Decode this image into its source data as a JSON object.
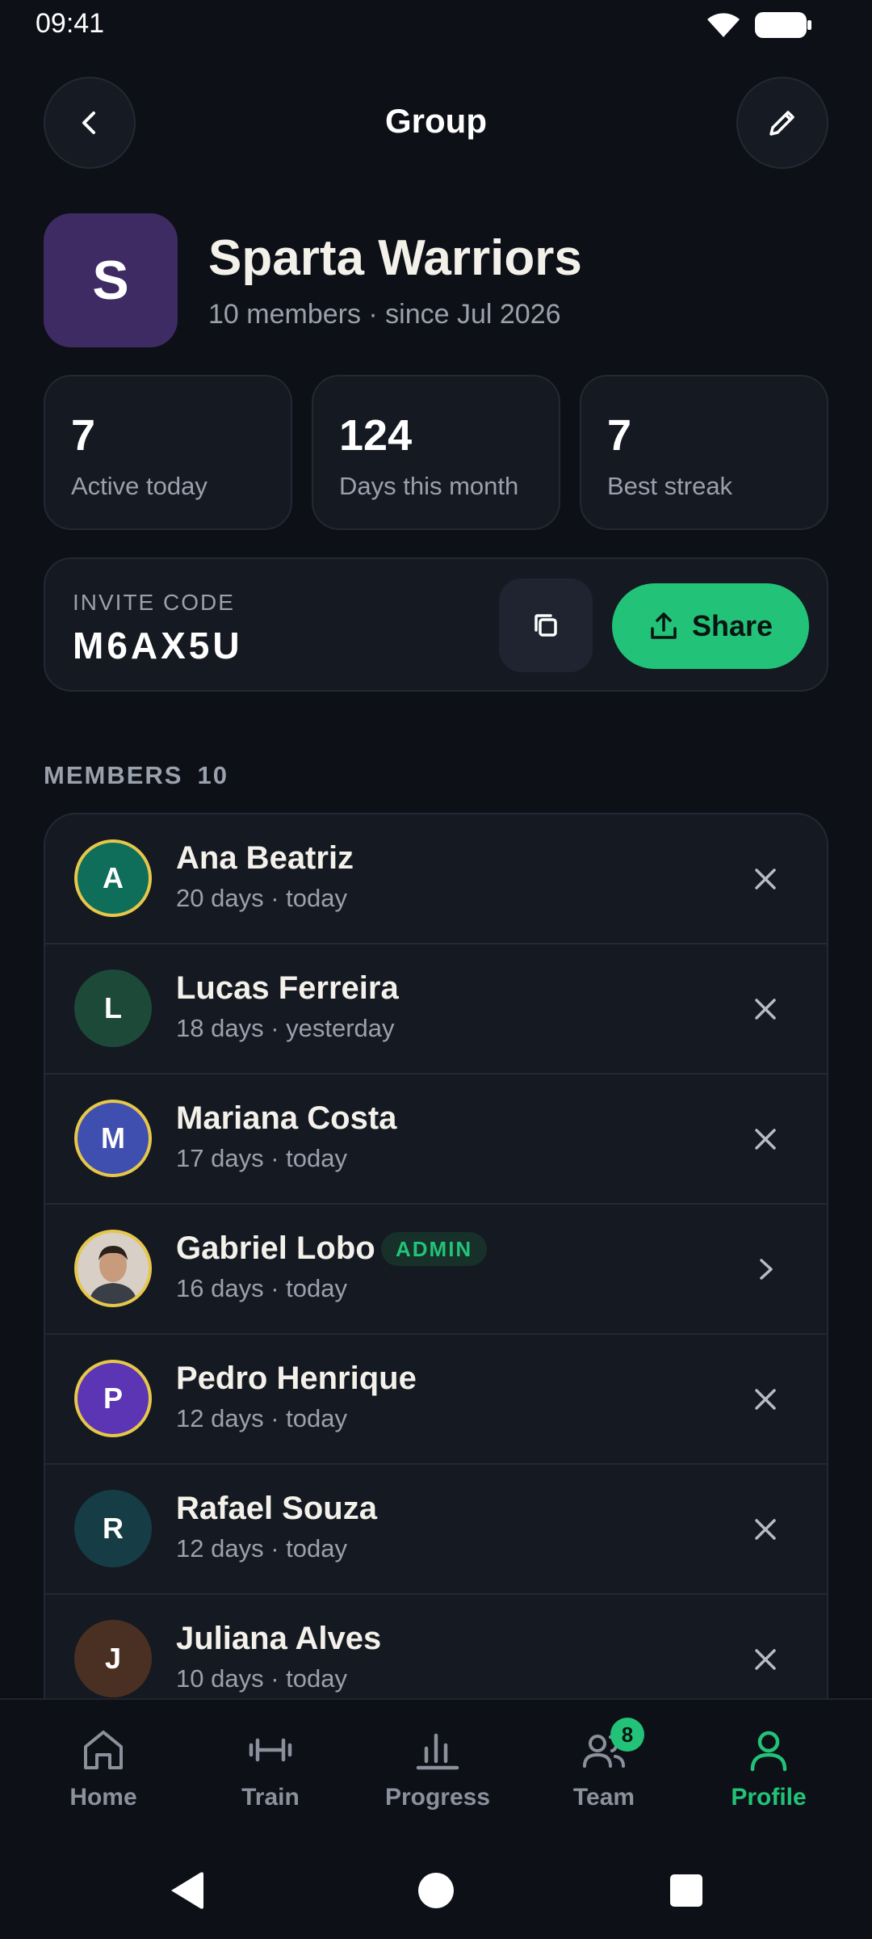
{
  "status_bar": {
    "time": "09:41"
  },
  "header": {
    "title": "Group"
  },
  "group": {
    "initial": "S",
    "name": "Sparta Warriors",
    "meta": "10 members · since Jul 2026",
    "avatar_color": "#3f2b63"
  },
  "stats": [
    {
      "value": "7",
      "label": "Active today"
    },
    {
      "value": "124",
      "label": "Days this month"
    },
    {
      "value": "7",
      "label": "Best streak"
    }
  ],
  "invite": {
    "label": "INVITE CODE",
    "code": "M6AX5U",
    "share_label": "Share"
  },
  "members_section": {
    "title": "MEMBERS",
    "count": "10"
  },
  "members": [
    {
      "initial": "A",
      "name": "Ana Beatriz",
      "meta": "20 days · today",
      "avatar_color": "#0f6e5a",
      "ring": true,
      "action": "remove-icon"
    },
    {
      "initial": "L",
      "name": "Lucas Ferreira",
      "meta": "18 days · yesterday",
      "avatar_color": "#1d4a38",
      "ring": false,
      "action": "remove-icon"
    },
    {
      "initial": "M",
      "name": "Mariana Costa",
      "meta": "17 days · today",
      "avatar_color": "#3f4fb0",
      "ring": true,
      "action": "remove-icon"
    },
    {
      "initial": "",
      "name": "Gabriel Lobo",
      "meta": "16 days · today",
      "badge": "ADMIN",
      "avatar_color": "#c9b9a8",
      "ring": true,
      "action": "chevron-right-icon"
    },
    {
      "initial": "P",
      "name": "Pedro Henrique",
      "meta": "12 days · today",
      "avatar_color": "#5b35b3",
      "ring": true,
      "action": "remove-icon"
    },
    {
      "initial": "R",
      "name": "Rafael Souza",
      "meta": "12 days · today",
      "avatar_color": "#163c46",
      "ring": false,
      "action": "remove-icon"
    },
    {
      "initial": "J",
      "name": "Juliana Alves",
      "meta": "10 days · today",
      "avatar_color": "#4a3022",
      "ring": false,
      "action": "remove-icon"
    }
  ],
  "bottom_nav": [
    {
      "label": "Home",
      "icon": "home-icon"
    },
    {
      "label": "Train",
      "icon": "dumbbell-icon"
    },
    {
      "label": "Progress",
      "icon": "chart-icon"
    },
    {
      "label": "Team",
      "icon": "team-icon",
      "badge": "8"
    },
    {
      "label": "Profile",
      "icon": "profile-icon",
      "active": true
    }
  ],
  "colors": {
    "background": "#0d1016",
    "card": "#151921",
    "accent": "#22c378",
    "ring": "#e6c74a",
    "muted_text": "#9aa1ad"
  }
}
